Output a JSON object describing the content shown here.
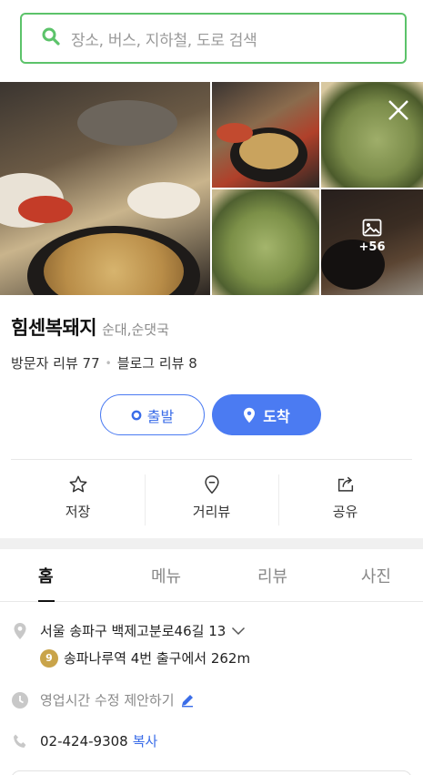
{
  "search": {
    "placeholder": "장소, 버스, 지하철, 도로 검색"
  },
  "photos": {
    "more_count": "+56"
  },
  "place": {
    "name": "힘센복돼지",
    "category": "순대,순댓국",
    "visitor_reviews": "방문자 리뷰 77",
    "blog_reviews": "블로그 리뷰 8"
  },
  "route": {
    "start_label": "출발",
    "arrive_label": "도착"
  },
  "actions": {
    "save": "저장",
    "street_view": "거리뷰",
    "share": "공유"
  },
  "tabs": [
    "홈",
    "메뉴",
    "리뷰",
    "사진"
  ],
  "info": {
    "address": "서울 송파구 백제고분로46길 13",
    "subway_line": "9",
    "subway_text": "송파나루역 4번 출구에서 262m",
    "hours_suggest": "영업시간 수정 제안하기",
    "phone": "02-424-9308",
    "copy_label": "복사"
  },
  "colors": {
    "accent_green": "#5cc36a",
    "accent_blue": "#4b7bf2",
    "line9": "#c9a44a"
  }
}
